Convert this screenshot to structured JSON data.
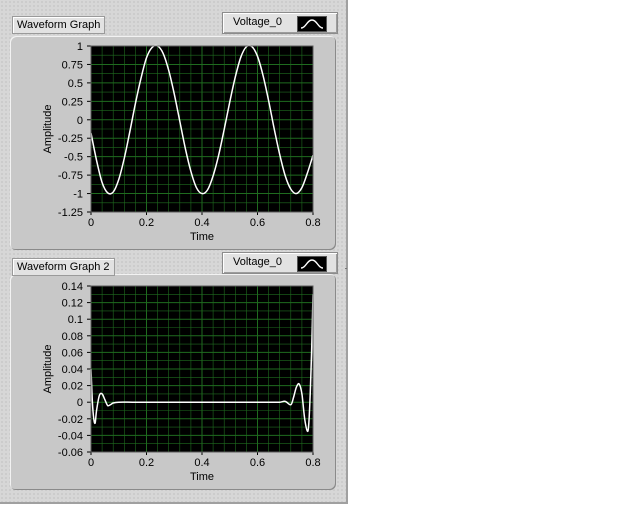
{
  "colors": {
    "plot_bg": "#000000",
    "grid": "#1f6b1f",
    "trace": "#ffffff",
    "panel": "#d7d7d7"
  },
  "graph1": {
    "title": "Waveform Graph",
    "legend": {
      "name": "Voltage_0",
      "icon": "line-legend-icon"
    },
    "xlabel": "Time",
    "ylabel": "Amplitude"
  },
  "graph2": {
    "title": "Waveform Graph 2",
    "legend": {
      "name": "Voltage_0",
      "icon": "line-legend-icon"
    },
    "xlabel": "Time",
    "ylabel": "Amplitude"
  },
  "chart_data": [
    {
      "type": "line",
      "title": "Waveform Graph",
      "xlabel": "Time",
      "ylabel": "Amplitude",
      "xlim": [
        0,
        0.8
      ],
      "ylim": [
        -1.25,
        1
      ],
      "x_ticks": [
        "0",
        "0.2",
        "0.4",
        "0.6",
        "0.8"
      ],
      "y_ticks": [
        "1",
        "0.75",
        "0.5",
        "0.25",
        "0",
        "-0.25",
        "-0.5",
        "-0.75",
        "-1",
        "-1.25"
      ],
      "grid": true,
      "legend_position": "top-right",
      "series": [
        {
          "name": "Voltage_0",
          "x": [
            0,
            0.02,
            0.04,
            0.06,
            0.08,
            0.1,
            0.12,
            0.14,
            0.16,
            0.18,
            0.2,
            0.22,
            0.24,
            0.26,
            0.28,
            0.3,
            0.32,
            0.34,
            0.36,
            0.38,
            0.4,
            0.42,
            0.44,
            0.46,
            0.48,
            0.5,
            0.52,
            0.54,
            0.56,
            0.58,
            0.6,
            0.62,
            0.64,
            0.66,
            0.68,
            0.7,
            0.72,
            0.74,
            0.76,
            0.78,
            0.8
          ],
          "y": [
            -0.18,
            -0.55,
            -0.85,
            -0.99,
            -0.98,
            -0.81,
            -0.52,
            -0.16,
            0.22,
            0.56,
            0.84,
            0.98,
            1.0,
            0.9,
            0.67,
            0.35,
            -0.02,
            -0.39,
            -0.7,
            -0.92,
            -1.0,
            -0.95,
            -0.76,
            -0.48,
            -0.13,
            0.24,
            0.58,
            0.85,
            0.99,
            0.99,
            0.86,
            0.6,
            0.26,
            -0.12,
            -0.47,
            -0.76,
            -0.94,
            -1.0,
            -0.92,
            -0.72,
            -0.48
          ]
        }
      ]
    },
    {
      "type": "line",
      "title": "Waveform Graph 2",
      "xlabel": "Time",
      "ylabel": "Amplitude",
      "xlim": [
        0,
        0.8
      ],
      "ylim": [
        -0.06,
        0.14
      ],
      "x_ticks": [
        "0",
        "0.2",
        "0.4",
        "0.6",
        "0.8"
      ],
      "y_ticks": [
        "0.14",
        "0.12",
        "0.1",
        "0.08",
        "0.06",
        "0.04",
        "0.02",
        "0",
        "-0.02",
        "-0.04",
        "-0.06"
      ],
      "grid": true,
      "legend_position": "top-right",
      "series": [
        {
          "name": "Voltage_0",
          "x": [
            0,
            0.005,
            0.01,
            0.015,
            0.02,
            0.03,
            0.04,
            0.05,
            0.06,
            0.07,
            0.08,
            0.1,
            0.15,
            0.2,
            0.3,
            0.4,
            0.5,
            0.6,
            0.65,
            0.68,
            0.7,
            0.72,
            0.73,
            0.74,
            0.75,
            0.76,
            0.77,
            0.78,
            0.785,
            0.79,
            0.795,
            0.8
          ],
          "y": [
            0.04,
            0.0,
            -0.02,
            -0.025,
            -0.01,
            0.008,
            0.01,
            0.003,
            -0.004,
            -0.003,
            -0.001,
            0.0,
            0.0,
            0.0,
            0.0,
            0.0,
            0.0,
            0.0,
            0.0,
            0.0,
            0.001,
            -0.003,
            0.006,
            0.018,
            0.022,
            0.01,
            -0.02,
            -0.035,
            -0.025,
            0.01,
            0.06,
            0.13
          ]
        }
      ]
    }
  ]
}
